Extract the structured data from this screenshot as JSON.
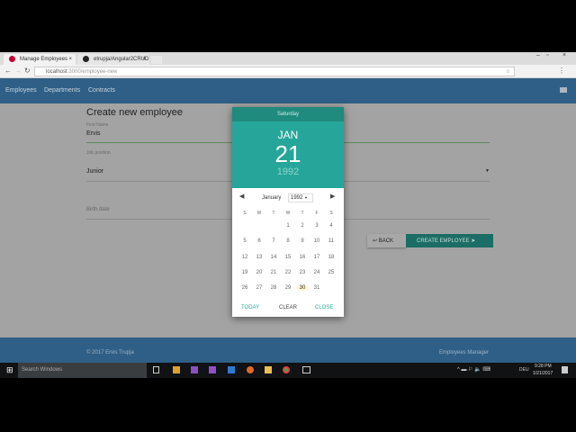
{
  "browser": {
    "tabs": [
      {
        "label": "Manage Employees"
      },
      {
        "label": "etrupja/Angular2CRUD"
      }
    ],
    "url_host": "localhost",
    "url_path": ":3000/employee-new"
  },
  "nav": {
    "links": [
      "Employees",
      "Departments",
      "Contracts"
    ]
  },
  "form": {
    "title": "Create new employee",
    "first_name_label": "First Name",
    "first_name_value": "Ervis",
    "job_label": "Job position",
    "job_value": "Junior",
    "birth_label": "Birth date",
    "back_label": "BACK",
    "create_label": "CREATE EMPLOYEE"
  },
  "datepicker": {
    "weekday": "Saturday",
    "month": "JAN",
    "day": "21",
    "year": "1992",
    "month_select": "January",
    "year_select": "1992",
    "weekday_headers": [
      "S",
      "M",
      "T",
      "W",
      "T",
      "F",
      "S"
    ],
    "first_weekday": 3,
    "days_in_month": 31,
    "hovered_day": 30,
    "today_label": "TODAY",
    "clear_label": "CLEAR",
    "close_label": "CLOSE"
  },
  "footer": {
    "copyright": "© 2017 Ervis Trupja",
    "app_name": "Employees Manager"
  },
  "taskbar": {
    "search_placeholder": "Search Windows",
    "lang": "DEU",
    "time": "9:28 PM",
    "date": "1/21/2017"
  },
  "colors": {
    "teal": "#26a69a",
    "teal_dark": "#1f8a7e",
    "nav": "#2f5f86"
  }
}
